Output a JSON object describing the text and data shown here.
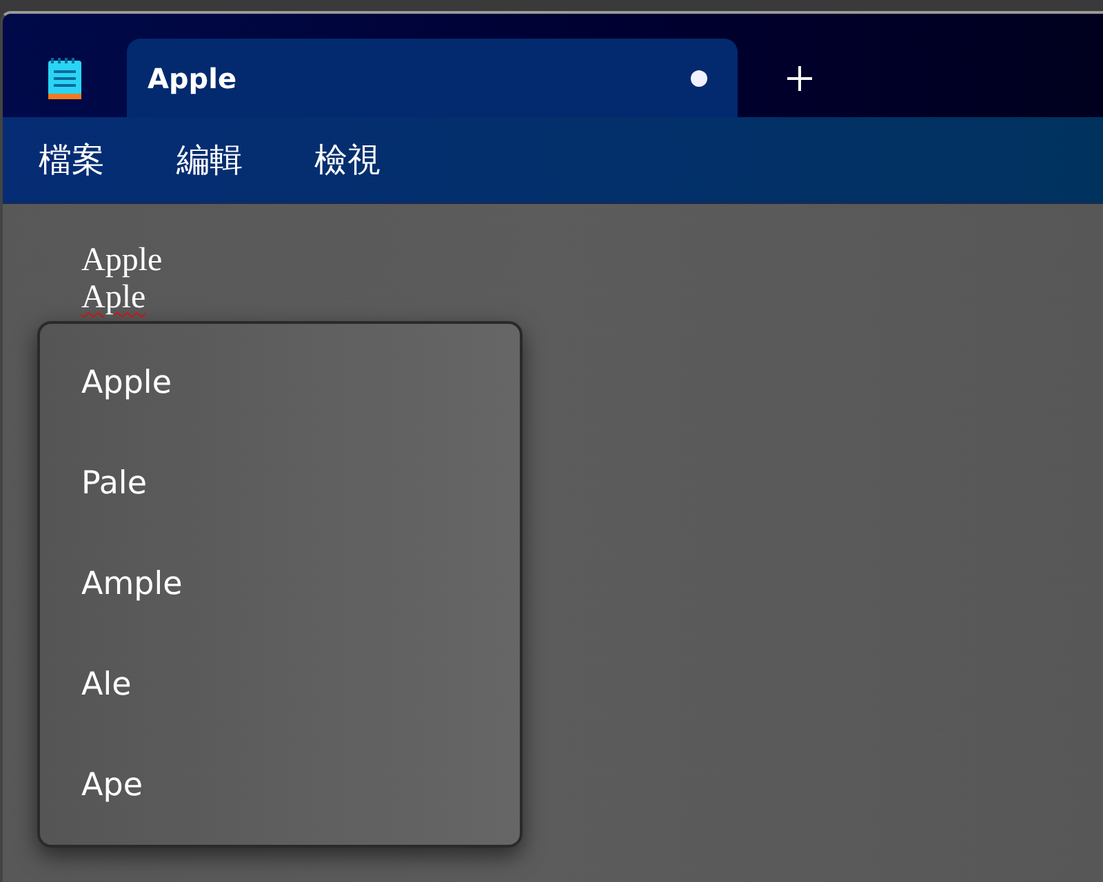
{
  "tabs": [
    {
      "label": "Apple",
      "selected": true,
      "modified": true
    }
  ],
  "menu": [
    "檔案",
    "編輯",
    "檢視"
  ],
  "lines": [
    {
      "text": "Apple",
      "misspelled": false
    },
    {
      "text": "Aple",
      "misspelled": true
    }
  ],
  "suggestions": [
    "Apple",
    "Pale",
    "Ample",
    "Ale",
    "Ape"
  ]
}
